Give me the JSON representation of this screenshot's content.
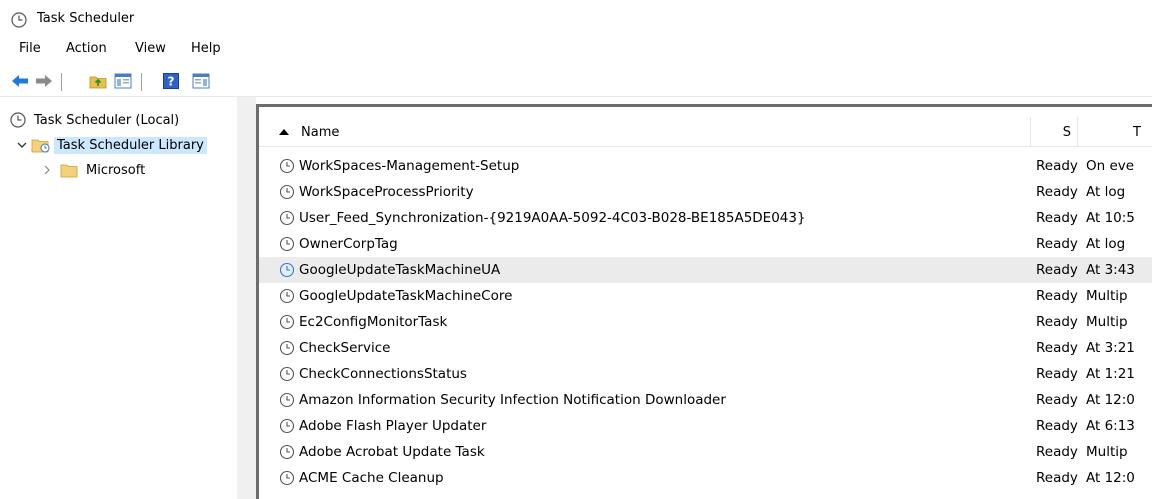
{
  "window": {
    "title": "Task Scheduler"
  },
  "menu": {
    "items": [
      "File",
      "Action",
      "View",
      "Help"
    ]
  },
  "tree": {
    "root_label": "Task Scheduler (Local)",
    "library_label": "Task Scheduler Library",
    "microsoft_label": "Microsoft"
  },
  "table": {
    "columns": {
      "name": "Name",
      "status": "S",
      "triggers": "T"
    },
    "rows": [
      {
        "name": "WorkSpaces-Management-Setup",
        "status": "Ready",
        "trigger": "On eve"
      },
      {
        "name": "WorkSpaceProcessPriority",
        "status": "Ready",
        "trigger": "At log"
      },
      {
        "name": "User_Feed_Synchronization-{9219A0AA-5092-4C03-B028-BE185A5DE043}",
        "status": "Ready",
        "trigger": "At 10:5"
      },
      {
        "name": "OwnerCorpTag",
        "status": "Ready",
        "trigger": "At log"
      },
      {
        "name": "GoogleUpdateTaskMachineUA",
        "status": "Ready",
        "trigger": "At 3:43"
      },
      {
        "name": "GoogleUpdateTaskMachineCore",
        "status": "Ready",
        "trigger": "Multip"
      },
      {
        "name": "Ec2ConfigMonitorTask",
        "status": "Ready",
        "trigger": "Multip"
      },
      {
        "name": "CheckService",
        "status": "Ready",
        "trigger": "At 3:21"
      },
      {
        "name": "CheckConnectionsStatus",
        "status": "Ready",
        "trigger": "At 1:21"
      },
      {
        "name": "Amazon Information Security Infection Notification Downloader",
        "status": "Ready",
        "trigger": "At 12:0"
      },
      {
        "name": "Adobe Flash Player Updater",
        "status": "Ready",
        "trigger": "At 6:13"
      },
      {
        "name": "Adobe Acrobat Update Task",
        "status": "Ready",
        "trigger": "Multip"
      },
      {
        "name": "ACME Cache Cleanup",
        "status": "Ready",
        "trigger": "At 12:0"
      }
    ],
    "selected_index": 4
  },
  "icons": {
    "app": "clock-icon",
    "back": "back-arrow-icon",
    "forward": "forward-arrow-icon",
    "up": "up-folder-icon",
    "show_hide": "show-hide-console-tree-icon",
    "help": "help-icon",
    "action_pane": "show-hide-action-pane-icon"
  },
  "colors": {
    "selection": "#cce8ff",
    "row_selected": "#ebebeb",
    "back_arrow": "#1e7ad6"
  }
}
